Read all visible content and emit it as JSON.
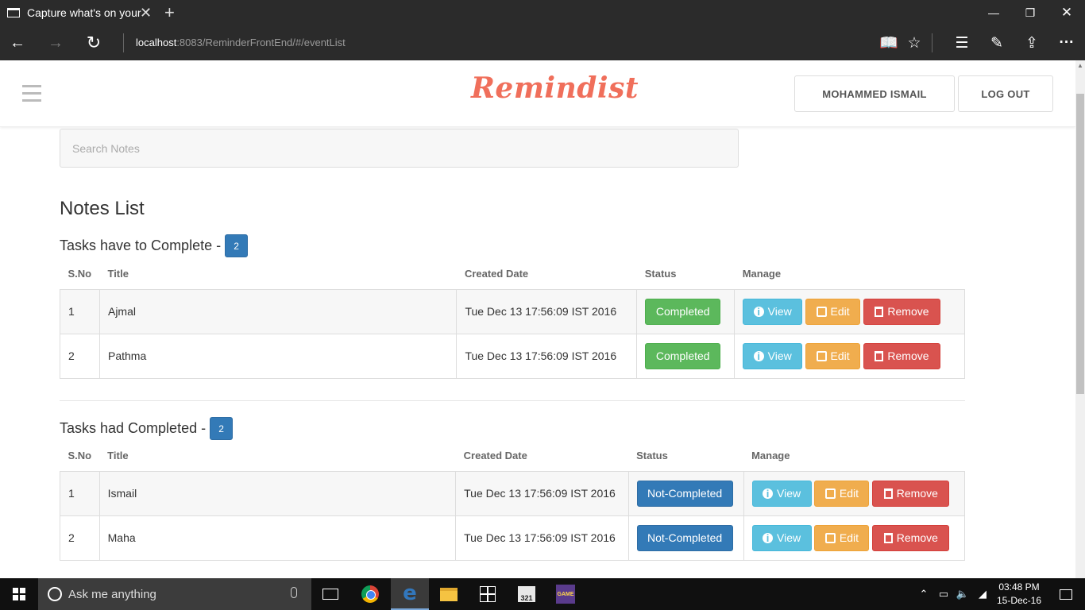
{
  "browser": {
    "tab_title": "Capture what's on your",
    "url_host": "localhost",
    "url_rest": ":8083/ReminderFrontEnd/#/eventList"
  },
  "header": {
    "brand": "Remindist",
    "user_button": "MOHAMMED ISMAIL",
    "logout_button": "LOG OUT"
  },
  "search": {
    "placeholder": "Search Notes"
  },
  "page_title": "Notes List",
  "sections": [
    {
      "title": "Tasks have to Complete -",
      "count": "2",
      "columns": [
        "S.No",
        "Title",
        "Created Date",
        "Status",
        "Manage"
      ],
      "rows": [
        {
          "sno": "1",
          "title": "Ajmal",
          "date": "Tue Dec 13 17:56:09 IST 2016",
          "status": "Completed"
        },
        {
          "sno": "2",
          "title": "Pathma",
          "date": "Tue Dec 13 17:56:09 IST 2016",
          "status": "Completed"
        }
      ]
    },
    {
      "title": "Tasks had Completed -",
      "count": "2",
      "columns": [
        "S.No",
        "Title",
        "Created Date",
        "Status",
        "Manage"
      ],
      "rows": [
        {
          "sno": "1",
          "title": "Ismail",
          "date": "Tue Dec 13 17:56:09 IST 2016",
          "status": "Not-Completed"
        },
        {
          "sno": "2",
          "title": "Maha",
          "date": "Tue Dec 13 17:56:09 IST 2016",
          "status": "Not-Completed"
        }
      ]
    }
  ],
  "actions": {
    "view": "View",
    "edit": "Edit",
    "remove": "Remove"
  },
  "taskbar": {
    "search_text": "Ask me anything",
    "media_label": "321",
    "game_label": "GAME",
    "time": "03:48 PM",
    "date": "15-Dec-16"
  },
  "colors": {
    "brand": "#f06f5b",
    "primary": "#337ab7",
    "success": "#5cb85c",
    "info": "#5bc0de",
    "warning": "#f0ad4e",
    "danger": "#d9534f"
  }
}
